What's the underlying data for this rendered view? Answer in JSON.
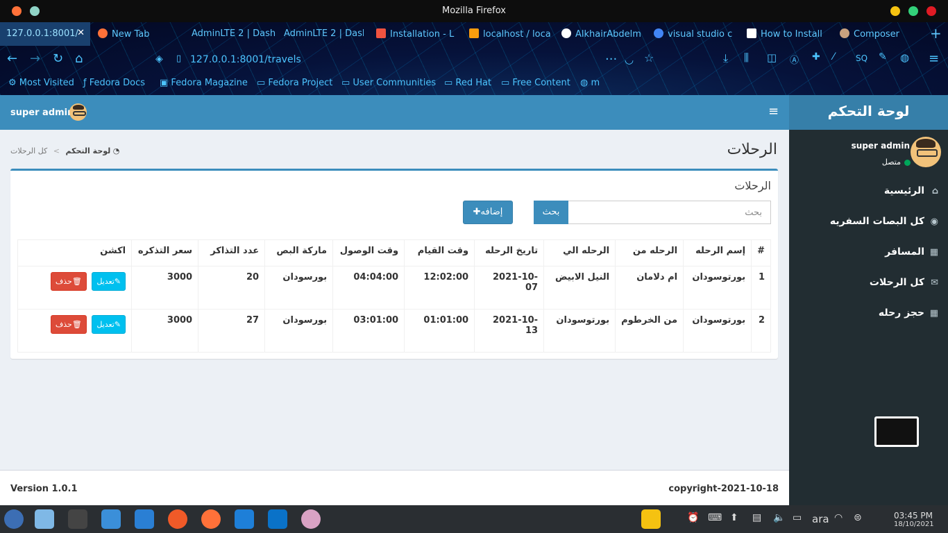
{
  "window": {
    "title": "Mozilla Firefox"
  },
  "tabs": [
    {
      "label": "127.0.0.1:8001/",
      "active": true
    },
    {
      "label": "New Tab"
    },
    {
      "label": "AdminLTE 2 | Dash"
    },
    {
      "label": "AdminLTE 2 | Dash"
    },
    {
      "label": "Installation - L"
    },
    {
      "label": "localhost / loca"
    },
    {
      "label": "AlkhairAbdelm"
    },
    {
      "label": "visual studio c"
    },
    {
      "label": "How to Install"
    },
    {
      "label": "Composer"
    }
  ],
  "url": "127.0.0.1:8001/travels",
  "bookmarks": [
    "Most Visited",
    "Fedora Docs",
    "Fedora Magazine",
    "Fedora Project",
    "User Communities",
    "Red Hat",
    "Free Content",
    "m"
  ],
  "header": {
    "user": "super admin"
  },
  "logo": "لوحة التحكم",
  "sidebar": {
    "user": "super admin",
    "status": "متصل",
    "items": [
      "الرئيسية",
      "كل البصات السفريه",
      "المسافر",
      "كل الرحلات",
      "حجز رحله"
    ]
  },
  "page": {
    "title": "الرحلات",
    "breadcrumb_home": "لوحة التحكم",
    "breadcrumb_current": "كل الرحلات"
  },
  "box": {
    "title": "الرحلات",
    "search_placeholder": "بحث",
    "search_button": "بحث",
    "add_button": "إضافه"
  },
  "table": {
    "headers": [
      "#",
      "إسم الرحله",
      "الرحله من",
      "الرحله الي",
      "تاريخ الرحله",
      "وقت القيام",
      "وقت الوصول",
      "ماركة البص",
      "عدد التذاكر",
      "سعر التذكره",
      "اكشن"
    ],
    "rows": [
      [
        "1",
        "بورتوسودان",
        "ام دلامان",
        "النيل الابيض",
        "2021-10-07",
        "12:02:00",
        "04:04:00",
        "بورسودان",
        "20",
        "3000"
      ],
      [
        "2",
        "بورتوسودان",
        "من الخرطوم",
        "بورتوسودان",
        "2021-10-13",
        "01:01:00",
        "03:01:00",
        "بورسودان",
        "27",
        "3000"
      ]
    ],
    "edit_label": "تعديل",
    "delete_label": "حذف"
  },
  "footer": {
    "copyright": "copyright-2021-10-18",
    "version": "Version 1.0.1"
  },
  "tray": {
    "lang": "ara",
    "time": "03:45 PM",
    "date": "18/10/2021"
  }
}
